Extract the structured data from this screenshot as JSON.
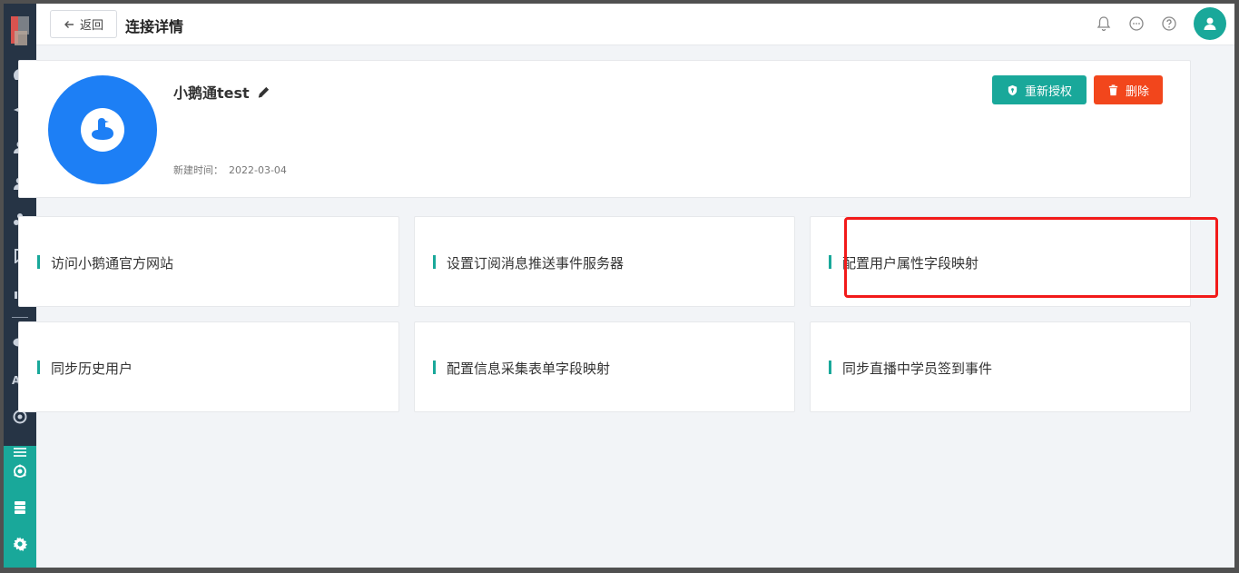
{
  "header": {
    "back_label": "返回",
    "title": "连接详情"
  },
  "profile": {
    "name": "小鹅通test",
    "date_label": "新建时间：",
    "date_value": "2022-03-04",
    "reauth_label": "重新授权",
    "delete_label": "删除"
  },
  "actions": [
    {
      "label": "访问小鹅通官方网站"
    },
    {
      "label": "设置订阅消息推送事件服务器"
    },
    {
      "label": "配置用户属性字段映射"
    },
    {
      "label": "同步历史用户"
    },
    {
      "label": "配置信息采集表单字段映射"
    },
    {
      "label": "同步直播中学员签到事件"
    }
  ],
  "sidebar": {
    "ad_label": "Ad",
    "icons": [
      "dashboard-icon",
      "send-icon",
      "user-icon",
      "users-icon",
      "group-icon",
      "bookmark-icon",
      "bar-chart-icon",
      "wechat-icon",
      "ad-icon",
      "target-icon",
      "list-icon",
      "network-icon",
      "server-icon",
      "gear-icon"
    ]
  },
  "colors": {
    "accent": "#19a89a",
    "danger": "#f2461c",
    "brand_blue": "#1d7ff5",
    "sidebar_bg": "#263445",
    "highlight": "#f21a1a"
  }
}
